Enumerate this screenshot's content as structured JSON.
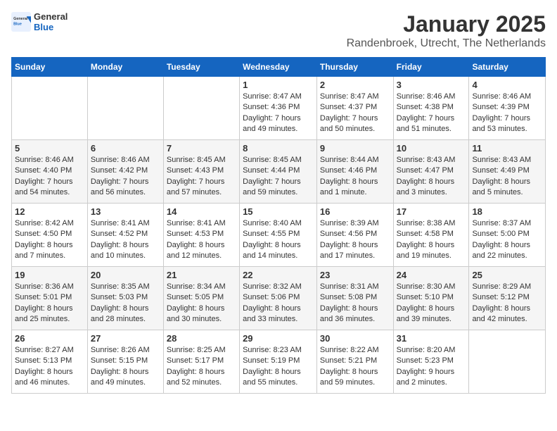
{
  "header": {
    "logo_general": "General",
    "logo_blue": "Blue",
    "title": "January 2025",
    "subtitle": "Randenbroek, Utrecht, The Netherlands"
  },
  "calendar": {
    "days_of_week": [
      "Sunday",
      "Monday",
      "Tuesday",
      "Wednesday",
      "Thursday",
      "Friday",
      "Saturday"
    ],
    "weeks": [
      [
        {
          "day": "",
          "info": ""
        },
        {
          "day": "",
          "info": ""
        },
        {
          "day": "",
          "info": ""
        },
        {
          "day": "1",
          "info": "Sunrise: 8:47 AM\nSunset: 4:36 PM\nDaylight: 7 hours\nand 49 minutes."
        },
        {
          "day": "2",
          "info": "Sunrise: 8:47 AM\nSunset: 4:37 PM\nDaylight: 7 hours\nand 50 minutes."
        },
        {
          "day": "3",
          "info": "Sunrise: 8:46 AM\nSunset: 4:38 PM\nDaylight: 7 hours\nand 51 minutes."
        },
        {
          "day": "4",
          "info": "Sunrise: 8:46 AM\nSunset: 4:39 PM\nDaylight: 7 hours\nand 53 minutes."
        }
      ],
      [
        {
          "day": "5",
          "info": "Sunrise: 8:46 AM\nSunset: 4:40 PM\nDaylight: 7 hours\nand 54 minutes."
        },
        {
          "day": "6",
          "info": "Sunrise: 8:46 AM\nSunset: 4:42 PM\nDaylight: 7 hours\nand 56 minutes."
        },
        {
          "day": "7",
          "info": "Sunrise: 8:45 AM\nSunset: 4:43 PM\nDaylight: 7 hours\nand 57 minutes."
        },
        {
          "day": "8",
          "info": "Sunrise: 8:45 AM\nSunset: 4:44 PM\nDaylight: 7 hours\nand 59 minutes."
        },
        {
          "day": "9",
          "info": "Sunrise: 8:44 AM\nSunset: 4:46 PM\nDaylight: 8 hours\nand 1 minute."
        },
        {
          "day": "10",
          "info": "Sunrise: 8:43 AM\nSunset: 4:47 PM\nDaylight: 8 hours\nand 3 minutes."
        },
        {
          "day": "11",
          "info": "Sunrise: 8:43 AM\nSunset: 4:49 PM\nDaylight: 8 hours\nand 5 minutes."
        }
      ],
      [
        {
          "day": "12",
          "info": "Sunrise: 8:42 AM\nSunset: 4:50 PM\nDaylight: 8 hours\nand 7 minutes."
        },
        {
          "day": "13",
          "info": "Sunrise: 8:41 AM\nSunset: 4:52 PM\nDaylight: 8 hours\nand 10 minutes."
        },
        {
          "day": "14",
          "info": "Sunrise: 8:41 AM\nSunset: 4:53 PM\nDaylight: 8 hours\nand 12 minutes."
        },
        {
          "day": "15",
          "info": "Sunrise: 8:40 AM\nSunset: 4:55 PM\nDaylight: 8 hours\nand 14 minutes."
        },
        {
          "day": "16",
          "info": "Sunrise: 8:39 AM\nSunset: 4:56 PM\nDaylight: 8 hours\nand 17 minutes."
        },
        {
          "day": "17",
          "info": "Sunrise: 8:38 AM\nSunset: 4:58 PM\nDaylight: 8 hours\nand 19 minutes."
        },
        {
          "day": "18",
          "info": "Sunrise: 8:37 AM\nSunset: 5:00 PM\nDaylight: 8 hours\nand 22 minutes."
        }
      ],
      [
        {
          "day": "19",
          "info": "Sunrise: 8:36 AM\nSunset: 5:01 PM\nDaylight: 8 hours\nand 25 minutes."
        },
        {
          "day": "20",
          "info": "Sunrise: 8:35 AM\nSunset: 5:03 PM\nDaylight: 8 hours\nand 28 minutes."
        },
        {
          "day": "21",
          "info": "Sunrise: 8:34 AM\nSunset: 5:05 PM\nDaylight: 8 hours\nand 30 minutes."
        },
        {
          "day": "22",
          "info": "Sunrise: 8:32 AM\nSunset: 5:06 PM\nDaylight: 8 hours\nand 33 minutes."
        },
        {
          "day": "23",
          "info": "Sunrise: 8:31 AM\nSunset: 5:08 PM\nDaylight: 8 hours\nand 36 minutes."
        },
        {
          "day": "24",
          "info": "Sunrise: 8:30 AM\nSunset: 5:10 PM\nDaylight: 8 hours\nand 39 minutes."
        },
        {
          "day": "25",
          "info": "Sunrise: 8:29 AM\nSunset: 5:12 PM\nDaylight: 8 hours\nand 42 minutes."
        }
      ],
      [
        {
          "day": "26",
          "info": "Sunrise: 8:27 AM\nSunset: 5:13 PM\nDaylight: 8 hours\nand 46 minutes."
        },
        {
          "day": "27",
          "info": "Sunrise: 8:26 AM\nSunset: 5:15 PM\nDaylight: 8 hours\nand 49 minutes."
        },
        {
          "day": "28",
          "info": "Sunrise: 8:25 AM\nSunset: 5:17 PM\nDaylight: 8 hours\nand 52 minutes."
        },
        {
          "day": "29",
          "info": "Sunrise: 8:23 AM\nSunset: 5:19 PM\nDaylight: 8 hours\nand 55 minutes."
        },
        {
          "day": "30",
          "info": "Sunrise: 8:22 AM\nSunset: 5:21 PM\nDaylight: 8 hours\nand 59 minutes."
        },
        {
          "day": "31",
          "info": "Sunrise: 8:20 AM\nSunset: 5:23 PM\nDaylight: 9 hours\nand 2 minutes."
        },
        {
          "day": "",
          "info": ""
        }
      ]
    ]
  }
}
